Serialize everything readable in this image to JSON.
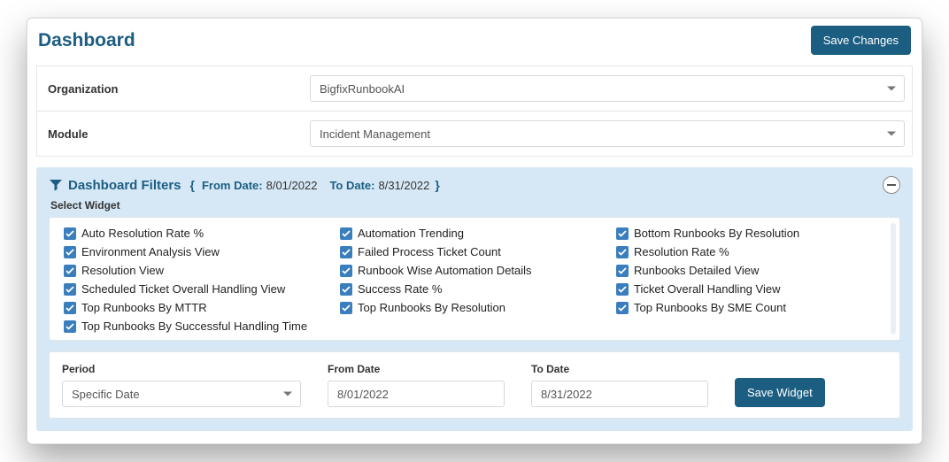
{
  "header": {
    "title": "Dashboard",
    "save_button": "Save Changes"
  },
  "topForm": {
    "organization_label": "Organization",
    "organization_value": "BigfixRunbookAI",
    "module_label": "Module",
    "module_value": "Incident Management"
  },
  "filters": {
    "title": "Dashboard Filters",
    "from_label": "From Date:",
    "from_value": "8/01/2022",
    "to_label": "To Date:",
    "to_value": "8/31/2022",
    "select_widget_label": "Select Widget",
    "save_widget_button": "Save Widget"
  },
  "widgets": {
    "col1": [
      "Auto Resolution Rate %",
      "Environment Analysis View",
      "Resolution View",
      "Scheduled Ticket Overall Handling View",
      "Top Runbooks By MTTR",
      "Top Runbooks By Successful Handling Time"
    ],
    "col2": [
      "Automation Trending",
      "Failed Process Ticket Count",
      "Runbook Wise Automation Details",
      "Success Rate %",
      "Top Runbooks By Resolution"
    ],
    "col3": [
      "Bottom Runbooks By Resolution",
      "Resolution Rate %",
      "Runbooks Detailed View",
      "Ticket Overall Handling View",
      "Top Runbooks By SME Count"
    ]
  },
  "period": {
    "period_label": "Period",
    "period_value": "Specific Date",
    "from_label": "From Date",
    "from_value": "8/01/2022",
    "to_label": "To Date",
    "to_value": "8/31/2022"
  }
}
